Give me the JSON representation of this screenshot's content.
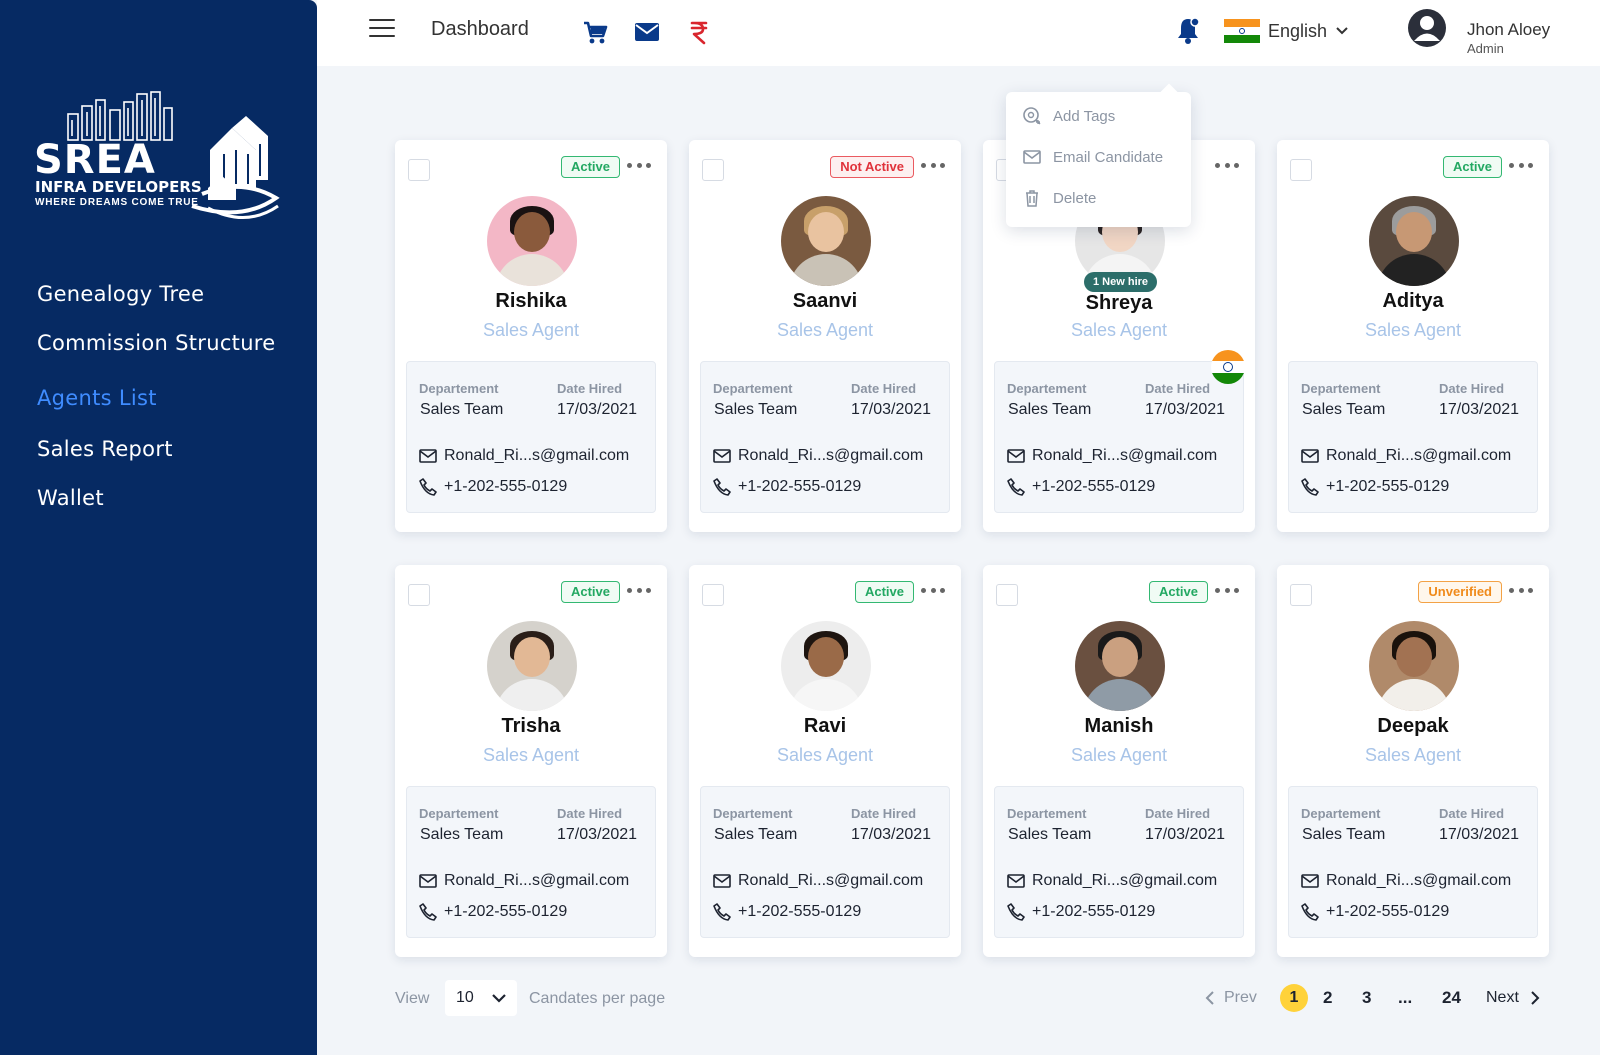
{
  "logo": {
    "brand": "SREA",
    "line1": "INFRA DEVELOPERS",
    "line2": "WHERE DREAMS COME TRUE"
  },
  "sidebar": {
    "items": [
      {
        "label": "Genealogy Tree",
        "active": false
      },
      {
        "label": "Commission Structure",
        "active": false
      },
      {
        "label": "Agents List",
        "active": true
      },
      {
        "label": "Sales Report",
        "active": false
      },
      {
        "label": "Wallet",
        "active": false
      }
    ]
  },
  "topbar": {
    "title": "Dashboard",
    "icons": [
      "menu-icon",
      "cart-icon",
      "mail-icon",
      "rupee-icon",
      "bell-icon"
    ],
    "language": "English",
    "user_name": "Jhon Aloey",
    "user_role": "Admin"
  },
  "context_menu": {
    "items": [
      {
        "label": "Add Tags",
        "icon": "tag-icon"
      },
      {
        "label": "Email Candidate",
        "icon": "mail-icon"
      },
      {
        "label": "Delete",
        "icon": "trash-icon"
      }
    ]
  },
  "card_labels": {
    "department": "Departement",
    "date_hired": "Date Hired"
  },
  "agents": [
    {
      "name": "Rishika",
      "role": "Sales Agent",
      "status": "Active",
      "department": "Sales Team",
      "date_hired": "17/03/2021",
      "email": "Ronald_Ri...s@gmail.com",
      "phone": "+1-202-555-0129"
    },
    {
      "name": "Saanvi",
      "role": "Sales Agent",
      "status": "Not Active",
      "department": "Sales Team",
      "date_hired": "17/03/2021",
      "email": "Ronald_Ri...s@gmail.com",
      "phone": "+1-202-555-0129"
    },
    {
      "name": "Shreya",
      "role": "Sales Agent",
      "status": "",
      "tag": "1 New hire",
      "department": "Sales Team",
      "date_hired": "17/03/2021",
      "email": "Ronald_Ri...s@gmail.com",
      "phone": "+1-202-555-0129"
    },
    {
      "name": "Aditya",
      "role": "Sales Agent",
      "status": "Active",
      "department": "Sales Team",
      "date_hired": "17/03/2021",
      "email": "Ronald_Ri...s@gmail.com",
      "phone": "+1-202-555-0129"
    },
    {
      "name": "Trisha",
      "role": "Sales Agent",
      "status": "Active",
      "department": "Sales Team",
      "date_hired": "17/03/2021",
      "email": "Ronald_Ri...s@gmail.com",
      "phone": "+1-202-555-0129"
    },
    {
      "name": "Ravi",
      "role": "Sales Agent",
      "status": "Active",
      "department": "Sales Team",
      "date_hired": "17/03/2021",
      "email": "Ronald_Ri...s@gmail.com",
      "phone": "+1-202-555-0129"
    },
    {
      "name": "Manish",
      "role": "Sales Agent",
      "status": "Active",
      "department": "Sales Team",
      "date_hired": "17/03/2021",
      "email": "Ronald_Ri...s@gmail.com",
      "phone": "+1-202-555-0129"
    },
    {
      "name": "Deepak",
      "role": "Sales Agent",
      "status": "Unverified",
      "department": "Sales Team",
      "date_hired": "17/03/2021",
      "email": "Ronald_Ri...s@gmail.com",
      "phone": "+1-202-555-0129"
    }
  ],
  "pagination": {
    "view_label": "View",
    "per_page_value": "10",
    "per_page_label": "Candates per page",
    "prev": "Prev",
    "next": "Next",
    "pages": [
      "1",
      "2",
      "3",
      "...",
      "24"
    ],
    "current": "1"
  },
  "colors": {
    "sidebar": "#062a63",
    "active_nav": "#3f8cff",
    "status_active": "#23a862",
    "status_not_active": "#e0323a",
    "status_unverified": "#f08a1a",
    "current_page": "#ffd23a"
  }
}
